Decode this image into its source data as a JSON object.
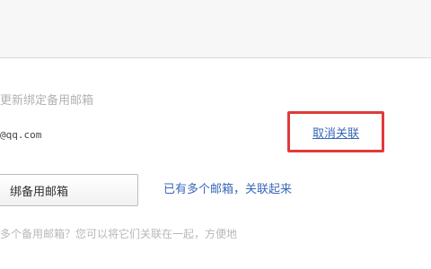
{
  "section": {
    "label": "更新绑定备用邮箱"
  },
  "bound_email": {
    "value": "@qq.com"
  },
  "actions": {
    "unlink_label": "取消关联",
    "add_backup_label": "绑备用邮箱",
    "multi_email_label": "已有多个邮箱，关联起来"
  },
  "hint": {
    "text": "多个备用邮箱？您可以将它们关联在一起，方便地"
  },
  "colors": {
    "link": "#3a68b8",
    "highlight_border": "#e03a3a"
  }
}
